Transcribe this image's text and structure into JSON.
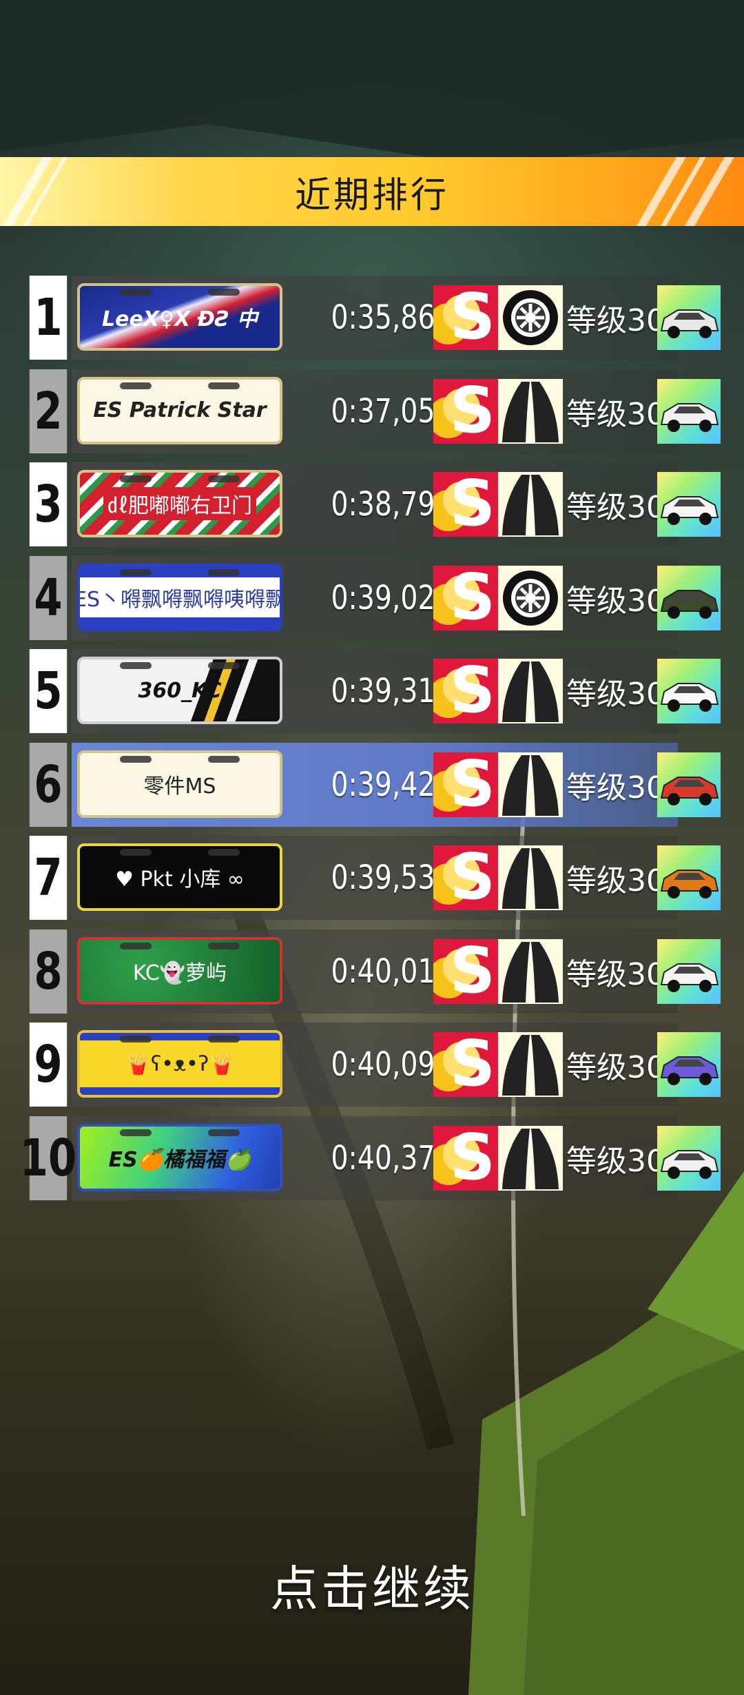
{
  "header": {
    "title": "近期排行"
  },
  "rows": [
    {
      "rank": "1",
      "plate": "LeeX♀X ƉƧ 中",
      "time": "0:35,86",
      "level": "等级30",
      "track": "tire-icon",
      "car_color": "#e8e8e8"
    },
    {
      "rank": "2",
      "plate": "ES Patrick Star",
      "time": "0:37,05",
      "level": "等级30",
      "track": "road-icon",
      "car_color": "#f0f0f0"
    },
    {
      "rank": "3",
      "plate": "㎗肥嘟嘟右卫门",
      "time": "0:38,79",
      "level": "等级30",
      "track": "road-icon",
      "car_color": "#f4f4f4"
    },
    {
      "rank": "4",
      "plate": "ES丶嘚飘嘚飘嘚咦嘚飘",
      "time": "0:39,02",
      "level": "等级30",
      "track": "tire-icon",
      "car_color": "#3d4a2c"
    },
    {
      "rank": "5",
      "plate": "360_KC",
      "time": "0:39,31",
      "level": "等级30",
      "track": "road-icon",
      "car_color": "#fafafa"
    },
    {
      "rank": "6",
      "plate": "零件MS",
      "time": "0:39,42",
      "level": "等级30",
      "track": "road-icon",
      "car_color": "#d83a2a"
    },
    {
      "rank": "7",
      "plate": "♥ Pkt 小库 ∞",
      "time": "0:39,53",
      "level": "等级30",
      "track": "road-icon",
      "car_color": "#e07a18"
    },
    {
      "rank": "8",
      "plate": "KC👻萝屿",
      "time": "0:40,01",
      "level": "等级30",
      "track": "road-icon",
      "car_color": "#f4f4f4"
    },
    {
      "rank": "9",
      "plate": "🍟ʕ•ᴥ•ʔ🍟",
      "time": "0:40,09",
      "level": "等级30",
      "track": "road-icon",
      "car_color": "#6c5ad8"
    },
    {
      "rank": "10",
      "plate": "ES🍊橘福福🍏",
      "time": "0:40,37",
      "level": "等级30",
      "track": "road-icon",
      "car_color": "#f0f0f0"
    }
  ],
  "footer": {
    "continue": "点击继续"
  }
}
